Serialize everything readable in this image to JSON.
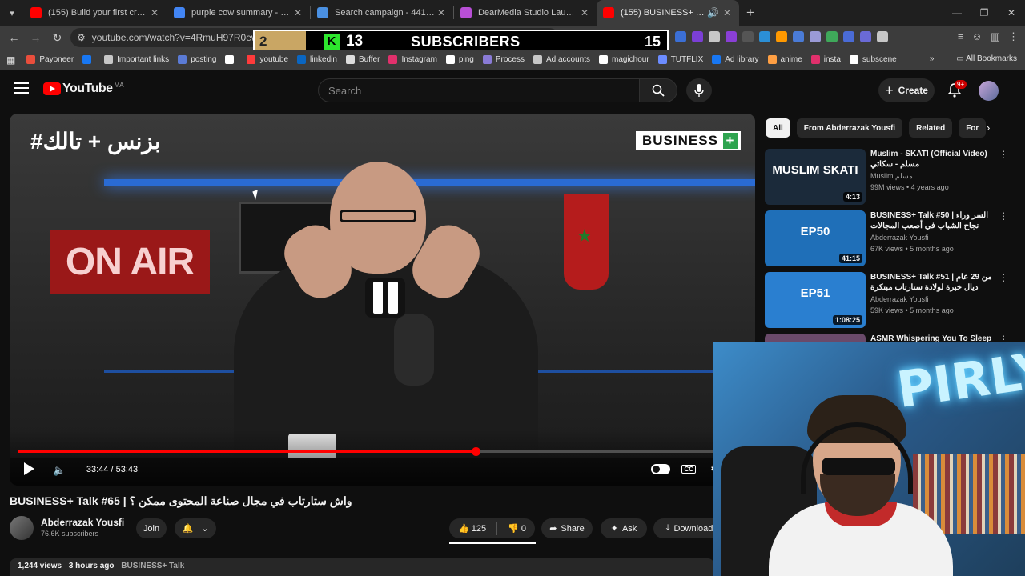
{
  "browser": {
    "tabs": [
      {
        "title": "(155) Build your first creative A",
        "icon_color": "#ff0000",
        "active": false
      },
      {
        "title": "purple cow summary - Google",
        "icon_color": "#4285f4",
        "active": false
      },
      {
        "title": "Search campaign - 441-976-65",
        "icon_color": "#4a90e2",
        "active": false
      },
      {
        "title": "DearMedia Studio Launch - Lo",
        "icon_color": "#b84fd6",
        "active": false
      },
      {
        "title": "(155) BUSINESS+ Talk #65 |",
        "icon_color": "#ff0000",
        "active": true
      }
    ],
    "url": "youtube.com/watch?v=4RmuH97R0ew&t=",
    "bookmarks": [
      {
        "label": "Payoneer",
        "color": "#e94e3c"
      },
      {
        "label": "",
        "color": "#1877f2"
      },
      {
        "label": "Important links",
        "color": "#c7c7c7"
      },
      {
        "label": "posting",
        "color": "#5b7bd6"
      },
      {
        "label": "",
        "color": "#ffffff"
      },
      {
        "label": "youtube",
        "color": "#ff3b3b"
      },
      {
        "label": "linkedin",
        "color": "#0a66c2"
      },
      {
        "label": "Buffer",
        "color": "#dddddd"
      },
      {
        "label": "Instagram",
        "color": "#e1306c"
      },
      {
        "label": "ping",
        "color": "#ffffff"
      },
      {
        "label": "Process",
        "color": "#8a7bd6"
      },
      {
        "label": "Ad accounts",
        "color": "#c7c7c7"
      },
      {
        "label": "magichour",
        "color": "#ffffff"
      },
      {
        "label": "TUTFLIX",
        "color": "#6c8cff"
      },
      {
        "label": "Ad library",
        "color": "#1877f2"
      },
      {
        "label": "anime",
        "color": "#ff9f43"
      },
      {
        "label": "insta",
        "color": "#e1306c"
      },
      {
        "label": "subscene",
        "color": "#ffffff"
      }
    ],
    "all_bookmarks": "All Bookmarks",
    "more_bookmarks": "»"
  },
  "sub_counter": {
    "left_value": "2",
    "k_letter": "K",
    "number": "13",
    "label": "SUBSCRIBERS",
    "right_value": "15"
  },
  "youtube": {
    "logo_text": "YouTube",
    "country_code": "MA",
    "search_placeholder": "Search",
    "create_label": "Create",
    "notification_badge": "9+"
  },
  "player": {
    "brand_arabic": "#بزنس + تالك",
    "brand_text": "BUSINESS",
    "brand_plus": "+",
    "on_air": "ON AIR",
    "current_time": "33:44",
    "duration": "53:43",
    "progress": 0.628
  },
  "video": {
    "title": "BUSINESS+ Talk #65 | واش ستارتاب في مجال صناعة المحتوى ممكن ؟",
    "channel": "Abderrazak Yousfi",
    "subscribers": "76.6K subscribers",
    "join": "Join",
    "likes": "125",
    "dislikes": "0",
    "share": "Share",
    "ask": "Ask",
    "download": "Download",
    "views": "1,244 views",
    "posted": "3 hours ago",
    "tag": "BUSINESS+ Talk"
  },
  "sidebar": {
    "chips": [
      "All",
      "From Abderrazak Yousfi",
      "Related",
      "For"
    ],
    "recommendations": [
      {
        "title": "Muslim - SKATI (Official Video) مسلم - سكاتي",
        "channel": "Muslim مسلم",
        "meta": "99M views • 4 years ago",
        "duration": "4:13",
        "thumb_text": "MUSLIM SKATI",
        "thumb_color": "#1b2a3a"
      },
      {
        "title": "BUSINESS+ Talk #50 | السر وراء نجاح الشباب في أصعب المجالات",
        "channel": "Abderrazak Yousfi",
        "meta": "67K views • 5 months ago",
        "duration": "41:15",
        "thumb_text": "EP50",
        "thumb_color": "#1f6fb8"
      },
      {
        "title": "BUSINESS+ Talk #51 | من 29 عام ديال خبرة لولادة ستارتاب مبتكرة",
        "channel": "Abderrazak Yousfi",
        "meta": "59K views • 5 months ago",
        "duration": "1:08:25",
        "thumb_text": "EP51",
        "thumb_color": "#2a7fd0"
      },
      {
        "title": "ASMR Whispering You To Sleep",
        "channel": "",
        "meta": "",
        "duration": "",
        "thumb_text": "ASMR",
        "thumb_color": "#6a4a6a"
      }
    ]
  },
  "webcam": {
    "neon_text": "PIRLY"
  }
}
